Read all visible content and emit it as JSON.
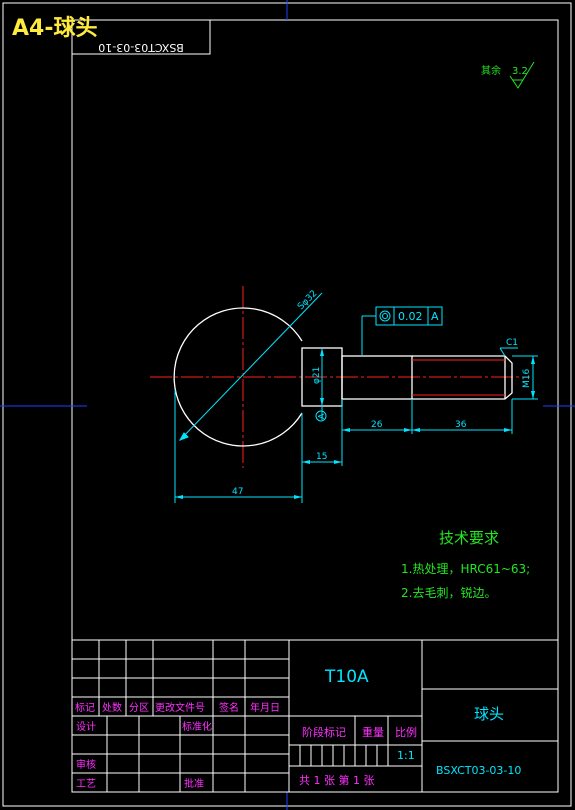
{
  "header": {
    "title": "A4-球头",
    "mirrored_code": "BSXCT03-03-10"
  },
  "surface_finish": {
    "label": "其余",
    "value": "3.2"
  },
  "dimensions": {
    "sphere": "Sφ32",
    "diameter_21": "φ21",
    "m16": "M16",
    "chamfer": "C1",
    "len_26": "26",
    "len_36": "36",
    "len_15": "15",
    "len_47": "47",
    "tolerance_value": "0.02",
    "tolerance_datum": "A",
    "datum_label": "A"
  },
  "requirements": {
    "title": "技术要求",
    "item1": "1.热处理，HRC61~63;",
    "item2": "2.去毛刺，锐边。"
  },
  "title_block": {
    "material": "T10A",
    "part_name": "球头",
    "drawing_no": "BSXCT03-03-10",
    "col_mark": "标记",
    "col_count": "处数",
    "col_zone": "分区",
    "col_doc": "更改文件号",
    "col_sign": "签名",
    "col_date": "年月日",
    "design": "设计",
    "standardize": "标准化",
    "review": "审核",
    "process": "工艺",
    "approve": "批准",
    "stage": "阶段标记",
    "weight": "重量",
    "scale": "比例",
    "scale_value": "1:1",
    "sheets": "共 1 张  第 1 张"
  },
  "colors": {
    "outline": "#ffffff",
    "dimension": "#00e5ff",
    "center_line": "#ff2020",
    "title_yellow": "#ffeb3b",
    "frame_blue": "#2040ff",
    "label_magenta": "#ff30ff",
    "requirement_green": "#22e622"
  }
}
